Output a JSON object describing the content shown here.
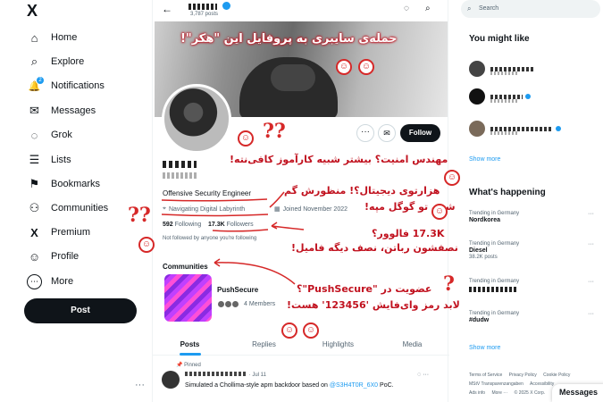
{
  "nav": {
    "logo": "X",
    "items": [
      {
        "label": "Home",
        "icon": "home-icon",
        "glyph": "⌂"
      },
      {
        "label": "Explore",
        "icon": "search-icon",
        "glyph": "⌕"
      },
      {
        "label": "Notifications",
        "icon": "bell-icon",
        "glyph": "🔔",
        "badge": "2"
      },
      {
        "label": "Messages",
        "icon": "mail-icon",
        "glyph": "✉"
      },
      {
        "label": "Grok",
        "icon": "grok-icon",
        "glyph": "◌"
      },
      {
        "label": "Lists",
        "icon": "list-icon",
        "glyph": "☰"
      },
      {
        "label": "Bookmarks",
        "icon": "bookmark-icon",
        "glyph": "⚑"
      },
      {
        "label": "Communities",
        "icon": "people-icon",
        "glyph": "⚇"
      },
      {
        "label": "Premium",
        "icon": "x-logo-icon",
        "glyph": "X"
      },
      {
        "label": "Profile",
        "icon": "person-icon",
        "glyph": "☺"
      },
      {
        "label": "More",
        "icon": "more-circle-icon",
        "glyph": "⋯"
      }
    ],
    "post_label": "Post",
    "more": "···"
  },
  "topbar": {
    "back": "←",
    "post_count": "3,787 posts"
  },
  "profile": {
    "more": "···",
    "message": "✉",
    "follow_label": "Follow",
    "bio": "Offensive Security Engineer",
    "location": "Navigating Digital Labyrinth",
    "joined": "Joined November 2022",
    "following_count": "592",
    "following_label": "Following",
    "followers_count": "17.3K",
    "followers_label": "Followers",
    "not_followed": "Not followed by anyone you're following"
  },
  "communities": {
    "heading": "Communities",
    "name": "PushSecure",
    "members_count": "4",
    "members_label": "Members"
  },
  "tabs": [
    "Posts",
    "Replies",
    "Highlights",
    "Media"
  ],
  "tweet": {
    "pinned": "Pinned",
    "date": "· Jul 11",
    "text_before": "Simulated a Chollima-style apm backdoor based on ",
    "mention": "@S3H4T0R_6X0",
    "text_after": " PoC."
  },
  "right": {
    "search_placeholder": "Search",
    "you_might_like": "You might like",
    "show_more": "Show more",
    "whats_happening": "What's happening",
    "trends": [
      {
        "context": "Trending in Germany",
        "title": "Nordkorea",
        "posts": ""
      },
      {
        "context": "Trending in Germany",
        "title": "Diesel",
        "posts": "38.2K posts"
      },
      {
        "context": "Trending in Germany",
        "title": "",
        "posts": ""
      },
      {
        "context": "Trending in Germany",
        "title": "#dudw",
        "posts": ""
      }
    ],
    "footer": [
      "Terms of Service",
      "Privacy Policy",
      "Cookie Policy",
      "MStV Transparenzangaben",
      "Accessibility",
      "Ads info",
      "More ···",
      "© 2025 X Corp."
    ],
    "messages": "Messages"
  },
  "annotations": {
    "title": "حمله‌ی سایبری به پروفایل این \"هکر\"!",
    "security": "مهندس امنیت؟ بیشتر شبیه کارآموز کافی‌نته!",
    "digital_1": "هزارتوی دیجیتال؟! منظورش گم",
    "digital_2": "شدن تو گوگل مپه!",
    "followers_1": "17.3K فالوور؟",
    "followers_2": "نصفشون رباتن، نصف دیگه فامیل!",
    "pushsecure_1": "عضویت در \"PushSecure\"؟",
    "pushsecure_2": "لابد رمز وای‌فایش '123456' هست!"
  },
  "colors": {
    "accent": "#1d9bf0",
    "annotation": "#c1121f",
    "text": "#0f1419",
    "muted": "#536471"
  }
}
